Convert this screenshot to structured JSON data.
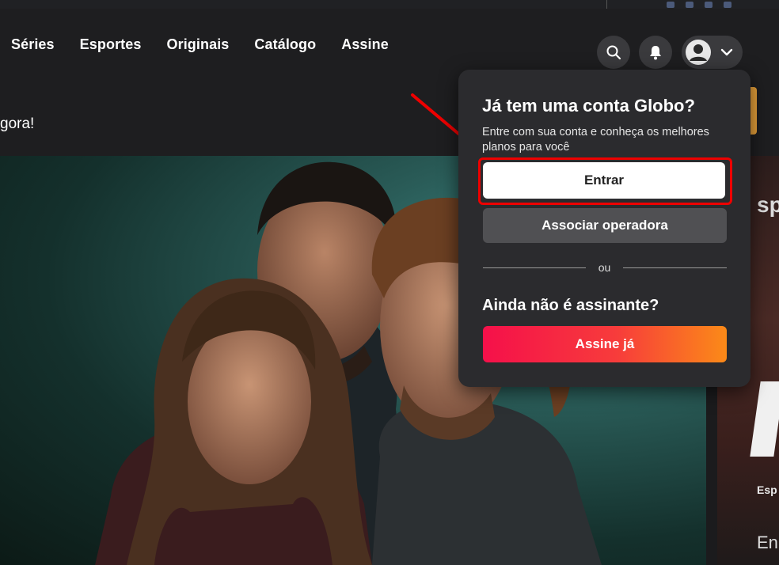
{
  "colors": {
    "accent_red": "#ee0000",
    "cta_gradient_start": "#f5104a",
    "cta_gradient_end": "#fb8a18",
    "background": "#1e1e20",
    "popup_bg": "#2b2b2e"
  },
  "nav": {
    "links": [
      "Séries",
      "Esportes",
      "Originais",
      "Catálogo",
      "Assine"
    ],
    "search_icon": "search-icon",
    "notification_icon": "bell-icon",
    "profile_icon": "user-avatar-icon",
    "profile_chevron": "chevron-down-icon"
  },
  "banner": {
    "text": "gora!"
  },
  "side_card": {
    "logo_text": "sp",
    "label": "Esp",
    "label2": "En"
  },
  "popup": {
    "title": "Já tem uma conta Globo?",
    "description": "Entre com sua conta e conheça os melhores planos para você",
    "primary_button": "Entrar",
    "secondary_button": "Associar operadora",
    "divider": "ou",
    "subtitle": "Ainda não é assinante?",
    "cta_button": "Assine já"
  }
}
